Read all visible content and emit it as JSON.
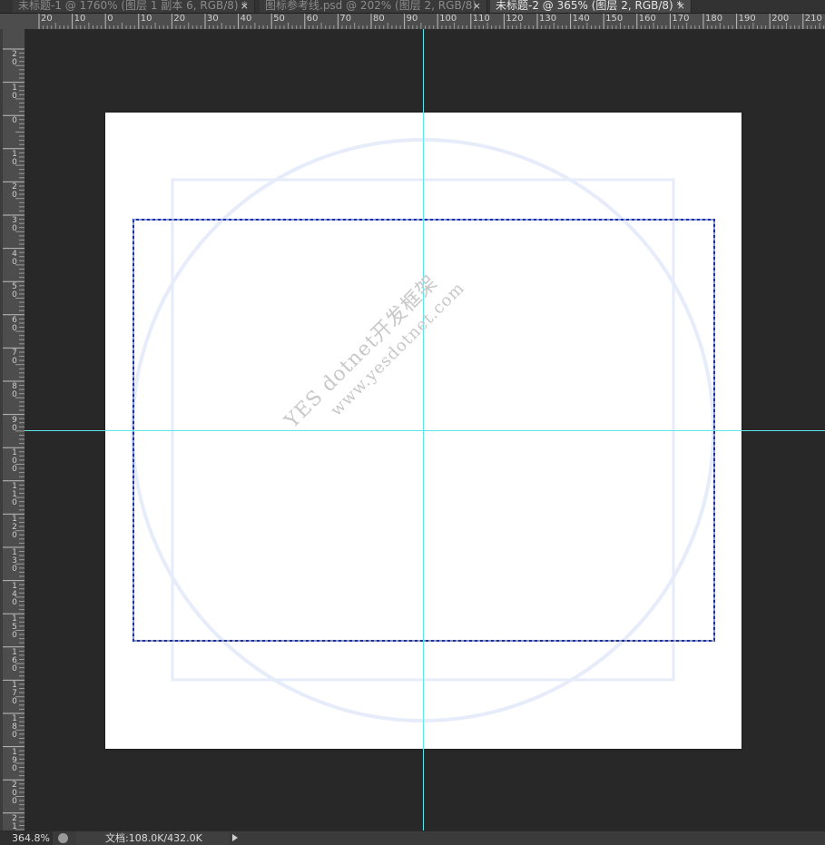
{
  "tabs": [
    {
      "title": "未标题-1 @ 1760% (图层 1 副本 6, RGB/8) *",
      "close": "×",
      "active": false
    },
    {
      "title": "图标参考线.psd @ 202% (图层 2, RGB/8)",
      "close": "×",
      "active": false
    },
    {
      "title": "未标题-2 @ 365% (图层 2, RGB/8) *",
      "close": "×",
      "active": true
    }
  ],
  "ruler_top": {
    "labels": [
      "20",
      "10",
      "0",
      "10",
      "20",
      "30",
      "40",
      "50",
      "60",
      "70",
      "80",
      "90",
      "100",
      "110",
      "120",
      "130",
      "140",
      "150",
      "160",
      "170",
      "180",
      "190",
      "200",
      "210"
    ]
  },
  "ruler_left": {
    "labels": [
      "20",
      "10",
      "0",
      "10",
      "20",
      "30",
      "40",
      "50",
      "60",
      "70",
      "80",
      "90",
      "100",
      "110",
      "120",
      "130",
      "140",
      "150",
      "160",
      "170",
      "180",
      "190",
      "200",
      "210"
    ]
  },
  "watermark": {
    "line1": "YES dotnet开发框架",
    "line2": "www.yesdotnet.com"
  },
  "status": {
    "zoom": "364.8%",
    "doc_info": "文档:108.0K/432.0K"
  },
  "colors": {
    "workspace": "#282828",
    "guide": "#5ee8e8",
    "selection": "#1a2fa0",
    "reference_shapes": "#e6ecfa"
  }
}
